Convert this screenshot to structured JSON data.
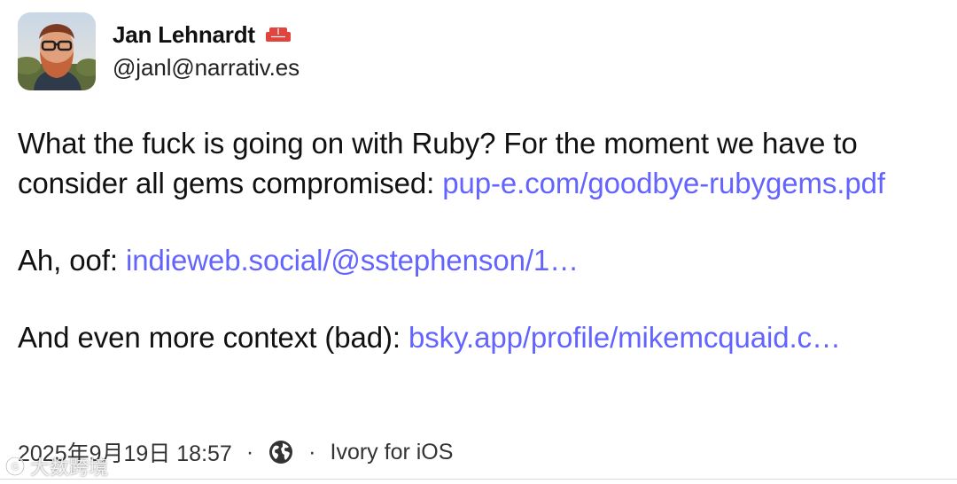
{
  "author": {
    "display_name": "Jan Lehnardt",
    "handle": "@janl@narrativ.es",
    "badge_icon": "sofa-icon",
    "badge_color": "#e0443e"
  },
  "post": {
    "paragraph1": {
      "text": "What the fuck is going on with Ruby? For the moment we have to consider all gems compromised: ",
      "link": "pup-e.com/goodbye-rubygems.pdf"
    },
    "paragraph2": {
      "text": "Ah, oof: ",
      "link": "indieweb.social/@sstephenson/1…"
    },
    "paragraph3": {
      "text": "And even more context (bad): ",
      "link": "bsky.app/profile/mikemcquaid.c…"
    }
  },
  "footer": {
    "timestamp": "2025年9月19日 18:57",
    "separator": "·",
    "visibility_icon": "globe-icon",
    "client": "Ivory for iOS"
  },
  "watermark": {
    "text": "大数跨境"
  },
  "colors": {
    "link": "#6364ff",
    "text": "#111111",
    "badge": "#e0443e"
  }
}
